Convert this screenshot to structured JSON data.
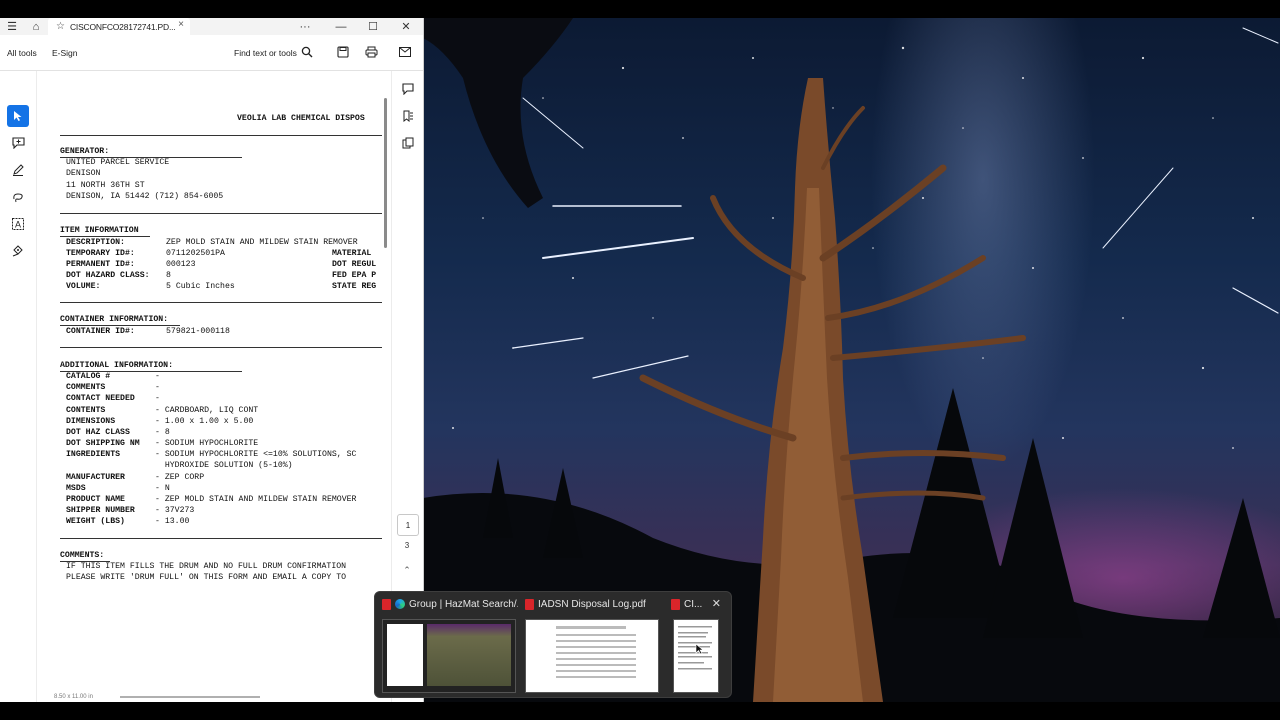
{
  "acrobat": {
    "tab_title": "CISCONFCO28172741.PD...",
    "toolbar": {
      "all_tools": "All tools",
      "esign": "E-Sign",
      "find": "Find text or tools"
    },
    "page_nav": {
      "current": "1",
      "total": "3"
    },
    "page_size": "8.50 x 11.00 in"
  },
  "document": {
    "header_title": "VEOLIA LAB CHEMICAL DISPOS",
    "generator": {
      "heading": "GENERATOR:",
      "lines": [
        "UNITED PARCEL SERVICE",
        "DENISON",
        "11 NORTH 36TH ST",
        "DENISON, IA 51442 (712) 854-6005"
      ]
    },
    "item": {
      "heading": "ITEM INFORMATION",
      "rows": [
        {
          "label": "DESCRIPTION:",
          "value": "ZEP MOLD STAIN AND MILDEW STAIN REMOVER",
          "right": ""
        },
        {
          "label": "TEMPORARY ID#:",
          "value": "0711202501PA",
          "right": "MATERIAL"
        },
        {
          "label": "PERMANENT ID#:",
          "value": "000123",
          "right": "DOT REGUL"
        },
        {
          "label": "DOT HAZARD CLASS:",
          "value": "8",
          "right": "FED EPA P"
        },
        {
          "label": "VOLUME:",
          "value": "5 Cubic Inches",
          "right": "STATE REG"
        }
      ]
    },
    "container": {
      "heading": "CONTAINER INFORMATION:",
      "label": "CONTAINER ID#:",
      "value": "579821-000118"
    },
    "additional": {
      "heading": "ADDITIONAL INFORMATION:",
      "rows": [
        {
          "label": "CATALOG #",
          "value": "-"
        },
        {
          "label": "COMMENTS",
          "value": "-"
        },
        {
          "label": "CONTACT NEEDED",
          "value": "-"
        },
        {
          "label": "CONTENTS",
          "value": "- CARDBOARD, LIQ CONT"
        },
        {
          "label": "DIMENSIONS",
          "value": "- 1.00 x 1.00 x 5.00"
        },
        {
          "label": "DOT HAZ CLASS",
          "value": "- 8"
        },
        {
          "label": "DOT SHIPPING NM",
          "value": "- SODIUM HYPOCHLORITE"
        },
        {
          "label": "INGREDIENTS",
          "value": "- SODIUM HYPOCHLORITE <=10% SOLUTIONS, SC"
        },
        {
          "label": "",
          "value": "  HYDROXIDE SOLUTION (5-10%)"
        },
        {
          "label": "MANUFACTURER",
          "value": "- ZEP CORP"
        },
        {
          "label": "MSDS",
          "value": "- N"
        },
        {
          "label": "PRODUCT NAME",
          "value": "- ZEP MOLD STAIN AND MILDEW STAIN REMOVER"
        },
        {
          "label": "SHIPPER NUMBER",
          "value": "- 37V273"
        },
        {
          "label": "WEIGHT (LBS)",
          "value": "- 13.00"
        }
      ]
    },
    "comments": {
      "heading": "COMMENTS:",
      "lines": [
        "IF THIS ITEM FILLS THE DRUM AND NO FULL DRUM CONFIRMATION",
        "PLEASE WRITE 'DRUM FULL' ON THIS FORM AND EMAIL A COPY TO"
      ]
    }
  },
  "taskbar_preview": {
    "items": [
      {
        "title": "Group | HazMat Search/...",
        "icon": "edge-icon"
      },
      {
        "title": "IADSN Disposal Log.pdf",
        "icon": "pdf-icon"
      },
      {
        "title": "CI...",
        "icon": "pdf-icon"
      }
    ]
  },
  "colors": {
    "accent": "#1473e6",
    "pdf_red": "#d9252a"
  }
}
